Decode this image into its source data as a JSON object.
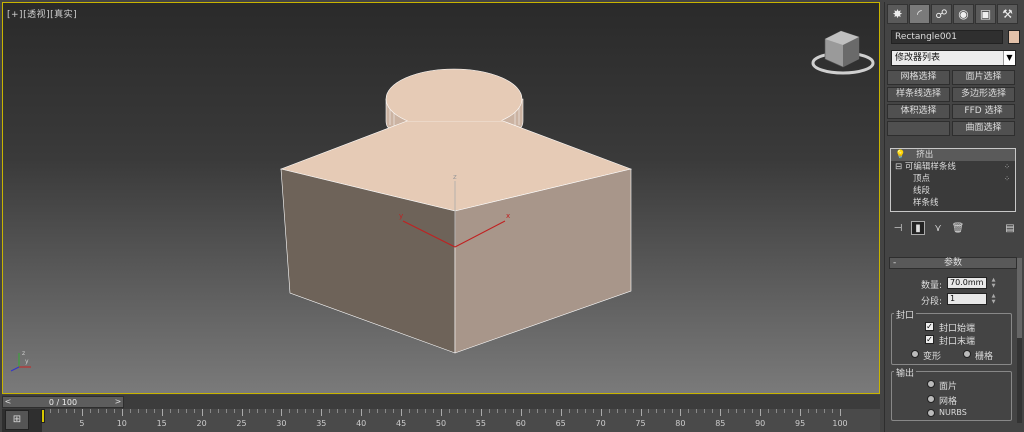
{
  "viewport": {
    "label": "[+][透视][真实]"
  },
  "panel": {
    "tabs": [
      "create",
      "modify",
      "hierarchy",
      "motion",
      "display",
      "utilities"
    ],
    "object_name": "Rectangle001",
    "object_color": "#e3c2aa",
    "modifier_list": "修改器列表",
    "modifier_buttons": [
      "网格选择",
      "面片选择",
      "样条线选择",
      "多边形选择",
      "体积选择",
      "FFD 选择",
      "",
      "曲面选择"
    ],
    "stack": {
      "items": [
        "挤出",
        "可编辑样条线",
        "顶点",
        "线段",
        "样条线"
      ]
    },
    "params": {
      "title": "参数",
      "amount_label": "数量:",
      "amount_value": "70.0mm",
      "segments_label": "分段:",
      "segments_value": "1",
      "cap_group": "封口",
      "cap_start": "封口始端",
      "cap_end": "封口末端",
      "morph": "变形",
      "grid": "栅格",
      "output_group": "输出",
      "out_patch": "面片",
      "out_mesh": "网格",
      "out_nurbs": "NURBS"
    }
  },
  "timeline": {
    "position": "0 / 100",
    "prev": "<",
    "next": ">",
    "ticks": [
      "5",
      "10",
      "15",
      "20",
      "25",
      "30",
      "35",
      "40",
      "45",
      "50",
      "55",
      "60",
      "65",
      "70",
      "75",
      "80",
      "85",
      "90",
      "95",
      "100"
    ]
  }
}
